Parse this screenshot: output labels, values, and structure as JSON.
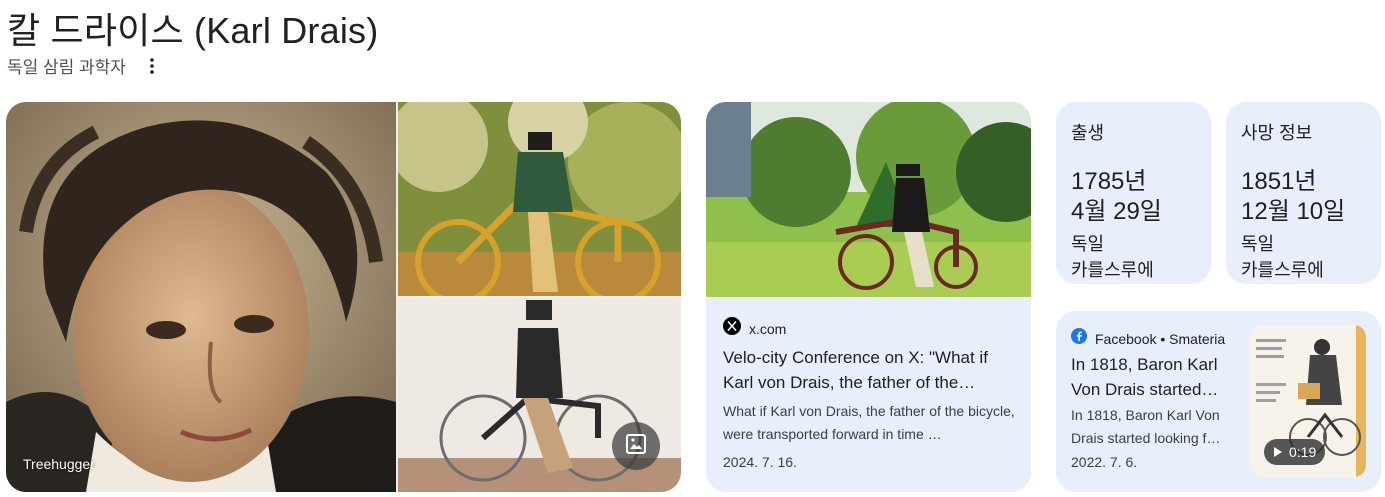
{
  "header": {
    "title": "칼 드라이스 (Karl Drais)",
    "subtitle": "독일 삼림 과학자"
  },
  "images": {
    "main_caption": "Treehugger"
  },
  "article_card": {
    "source": "x.com",
    "title": "Velo-city Conference on X: \"What if Karl von Drais, the father of the…",
    "snippet": "What if Karl von Drais, the father of the bicycle, were transported forward in time …",
    "date": "2024. 7. 16."
  },
  "facts": {
    "birth": {
      "label": "출생",
      "date_line1": "1785년",
      "date_line2": "4월 29일",
      "place_line1": "독일",
      "place_line2": "카를스루에"
    },
    "death": {
      "label": "사망 정보",
      "date_line1": "1851년",
      "date_line2": "12월 10일",
      "place_line1": "독일",
      "place_line2": "카를스루에"
    }
  },
  "video_card": {
    "source": "Facebook • Smateria",
    "title": "In 1818, Baron Karl Von Drais started…",
    "snippet": "In 1818, Baron Karl Von Drais started looking f…",
    "date": "2022. 7. 6.",
    "duration": "0:19"
  },
  "colors": {
    "card_background": "#e8eefb",
    "facebook_blue": "#1877f2"
  }
}
